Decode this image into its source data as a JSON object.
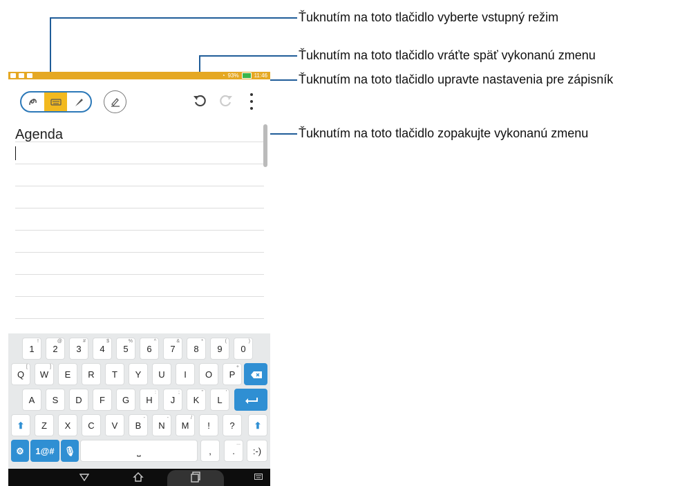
{
  "status_bar": {
    "battery_text": "93%",
    "time": "11:46"
  },
  "note": {
    "title": "Agenda"
  },
  "keyboard": {
    "row1": [
      {
        "label": "1",
        "hint": "!"
      },
      {
        "label": "2",
        "hint": "@"
      },
      {
        "label": "3",
        "hint": "#"
      },
      {
        "label": "4",
        "hint": "$"
      },
      {
        "label": "5",
        "hint": "%"
      },
      {
        "label": "6",
        "hint": "^"
      },
      {
        "label": "7",
        "hint": "&"
      },
      {
        "label": "8",
        "hint": "*"
      },
      {
        "label": "9",
        "hint": "("
      },
      {
        "label": "0",
        "hint": ")"
      }
    ],
    "row2": [
      {
        "label": "Q",
        "hint": "["
      },
      {
        "label": "W",
        "hint": "]"
      },
      {
        "label": "E",
        "hint": ""
      },
      {
        "label": "R",
        "hint": ""
      },
      {
        "label": "T",
        "hint": ""
      },
      {
        "label": "Y",
        "hint": ""
      },
      {
        "label": "U",
        "hint": ""
      },
      {
        "label": "I",
        "hint": ""
      },
      {
        "label": "O",
        "hint": ""
      },
      {
        "label": "P",
        "hint": "+"
      }
    ],
    "row3": [
      {
        "label": "A",
        "hint": ""
      },
      {
        "label": "S",
        "hint": ""
      },
      {
        "label": "D",
        "hint": ""
      },
      {
        "label": "F",
        "hint": ""
      },
      {
        "label": "G",
        "hint": ""
      },
      {
        "label": "H",
        "hint": ":"
      },
      {
        "label": "J",
        "hint": ";"
      },
      {
        "label": "K",
        "hint": "\""
      },
      {
        "label": "L",
        "hint": "'"
      }
    ],
    "row4": [
      {
        "label": "Z",
        "hint": ""
      },
      {
        "label": "X",
        "hint": ""
      },
      {
        "label": "C",
        "hint": ""
      },
      {
        "label": "V",
        "hint": ""
      },
      {
        "label": "B",
        "hint": "-"
      },
      {
        "label": "N",
        "hint": "-"
      },
      {
        "label": "M",
        "hint": "/"
      },
      {
        "label": "!",
        "hint": ""
      },
      {
        "label": "?",
        "hint": ""
      }
    ],
    "symbols_label": "1@#",
    "comma_label": ",",
    "period_label": ".",
    "period_hint": "...",
    "smiley_label": ":-)"
  },
  "callouts": {
    "input_mode": "Ťuknutím na toto tlačidlo vyberte vstupný režim",
    "undo": "Ťuknutím na toto tlačidlo vráťte späť vykonanú zmenu",
    "settings": "Ťuknutím na toto tlačidlo upravte nastavenia pre zápisník",
    "redo": "Ťuknutím na toto tlačidlo zopakujte vykonanú zmenu"
  },
  "colors": {
    "accent": "#2b78b8",
    "status_bar": "#e5a823",
    "highlight": "#f2b91f",
    "callout": "#1f5c98",
    "key_blue": "#2f8fd3"
  }
}
